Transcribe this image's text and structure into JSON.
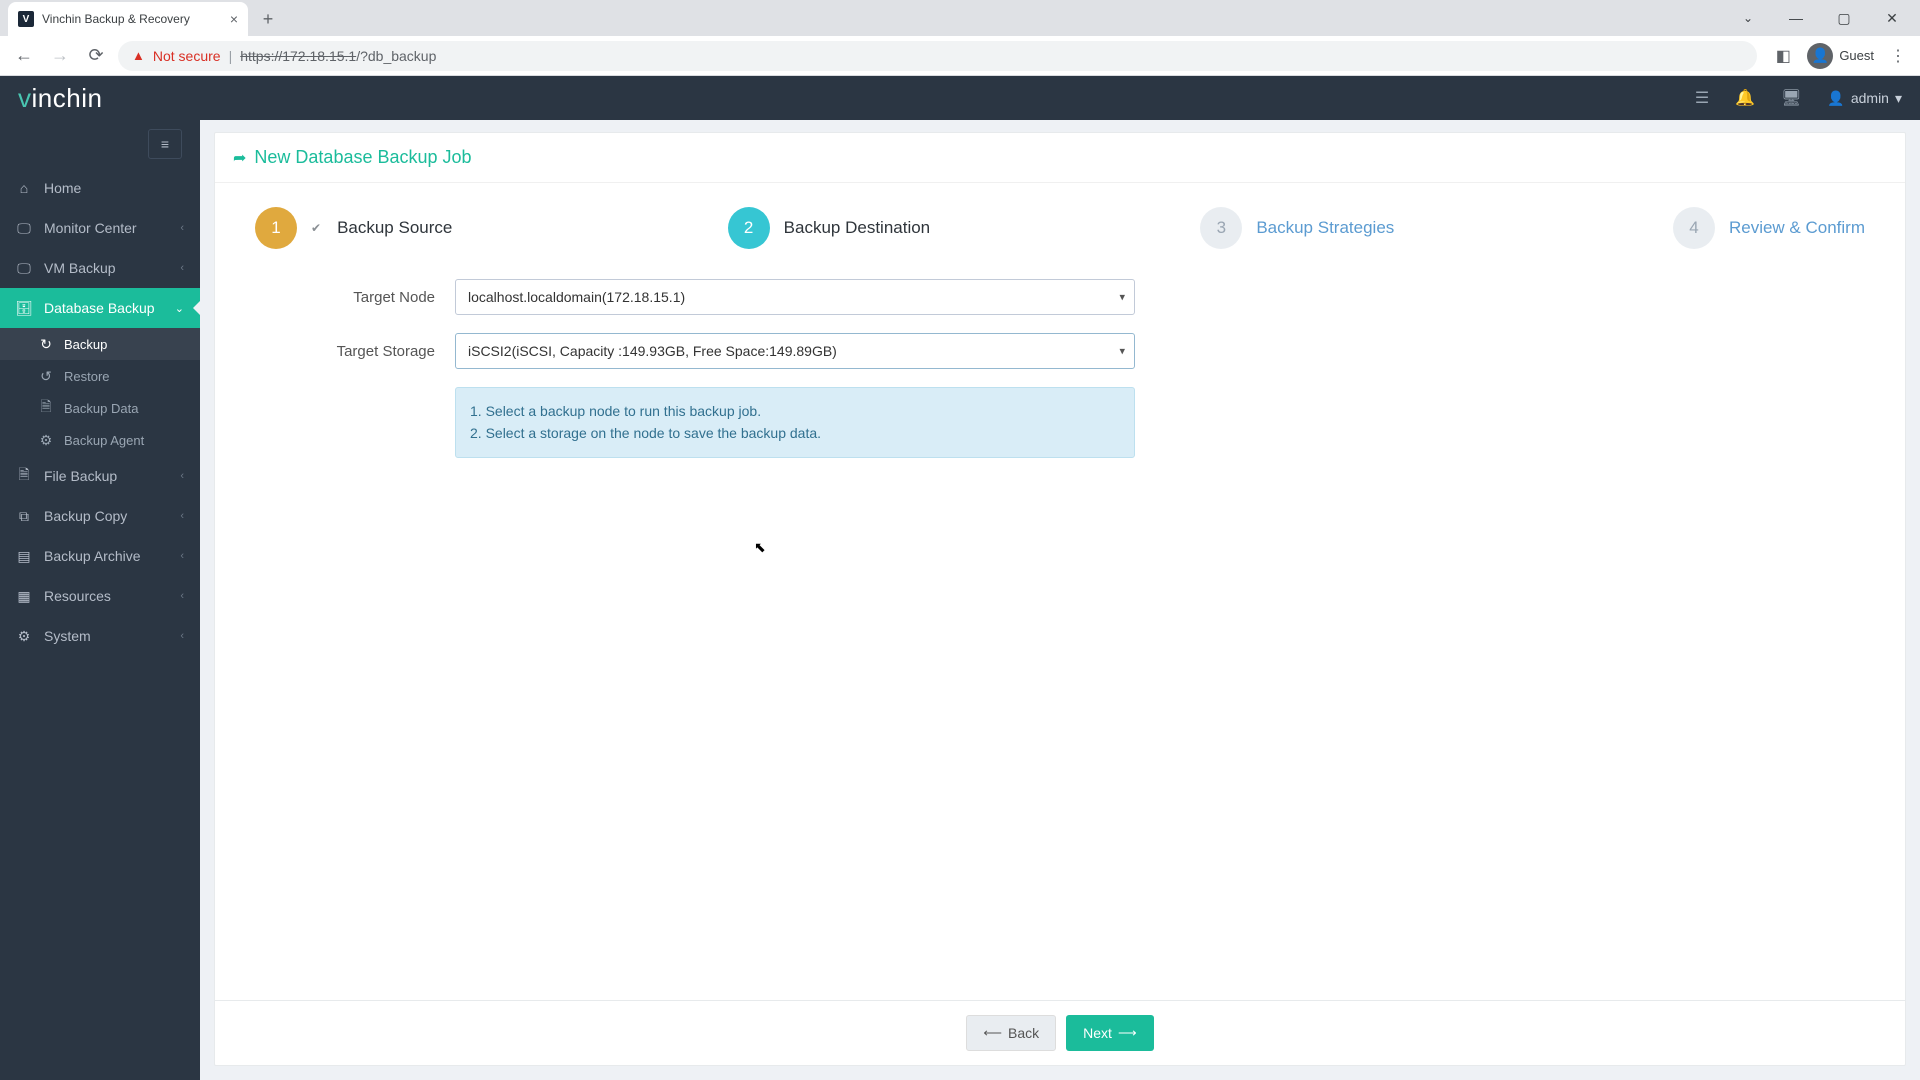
{
  "browser": {
    "tab_title": "Vinchin Backup & Recovery",
    "not_secure_label": "Not secure",
    "url_scheme_host": "https://172.18.15.1",
    "url_path": "/?db_backup",
    "guest_label": "Guest"
  },
  "header": {
    "user": "admin"
  },
  "sidebar": {
    "items": [
      {
        "label": "Home"
      },
      {
        "label": "Monitor Center"
      },
      {
        "label": "VM Backup"
      },
      {
        "label": "Database Backup"
      },
      {
        "label": "File Backup"
      },
      {
        "label": "Backup Copy"
      },
      {
        "label": "Backup Archive"
      },
      {
        "label": "Resources"
      },
      {
        "label": "System"
      }
    ],
    "db_children": [
      {
        "label": "Backup"
      },
      {
        "label": "Restore"
      },
      {
        "label": "Backup Data"
      },
      {
        "label": "Backup Agent"
      }
    ]
  },
  "page": {
    "title": "New Database Backup Job",
    "steps": [
      {
        "num": "1",
        "label": "Backup Source"
      },
      {
        "num": "2",
        "label": "Backup Destination"
      },
      {
        "num": "3",
        "label": "Backup Strategies"
      },
      {
        "num": "4",
        "label": "Review & Confirm"
      }
    ]
  },
  "form": {
    "target_node_label": "Target Node",
    "target_node_value": "localhost.localdomain(172.18.15.1)",
    "target_storage_label": "Target Storage",
    "target_storage_value": "iSCSI2(iSCSI, Capacity :149.93GB, Free Space:149.89GB)",
    "info_line1": "1. Select a backup node to run this backup job.",
    "info_line2": "2. Select a storage on the node to save the backup data."
  },
  "footer": {
    "back": "Back",
    "next": "Next"
  }
}
